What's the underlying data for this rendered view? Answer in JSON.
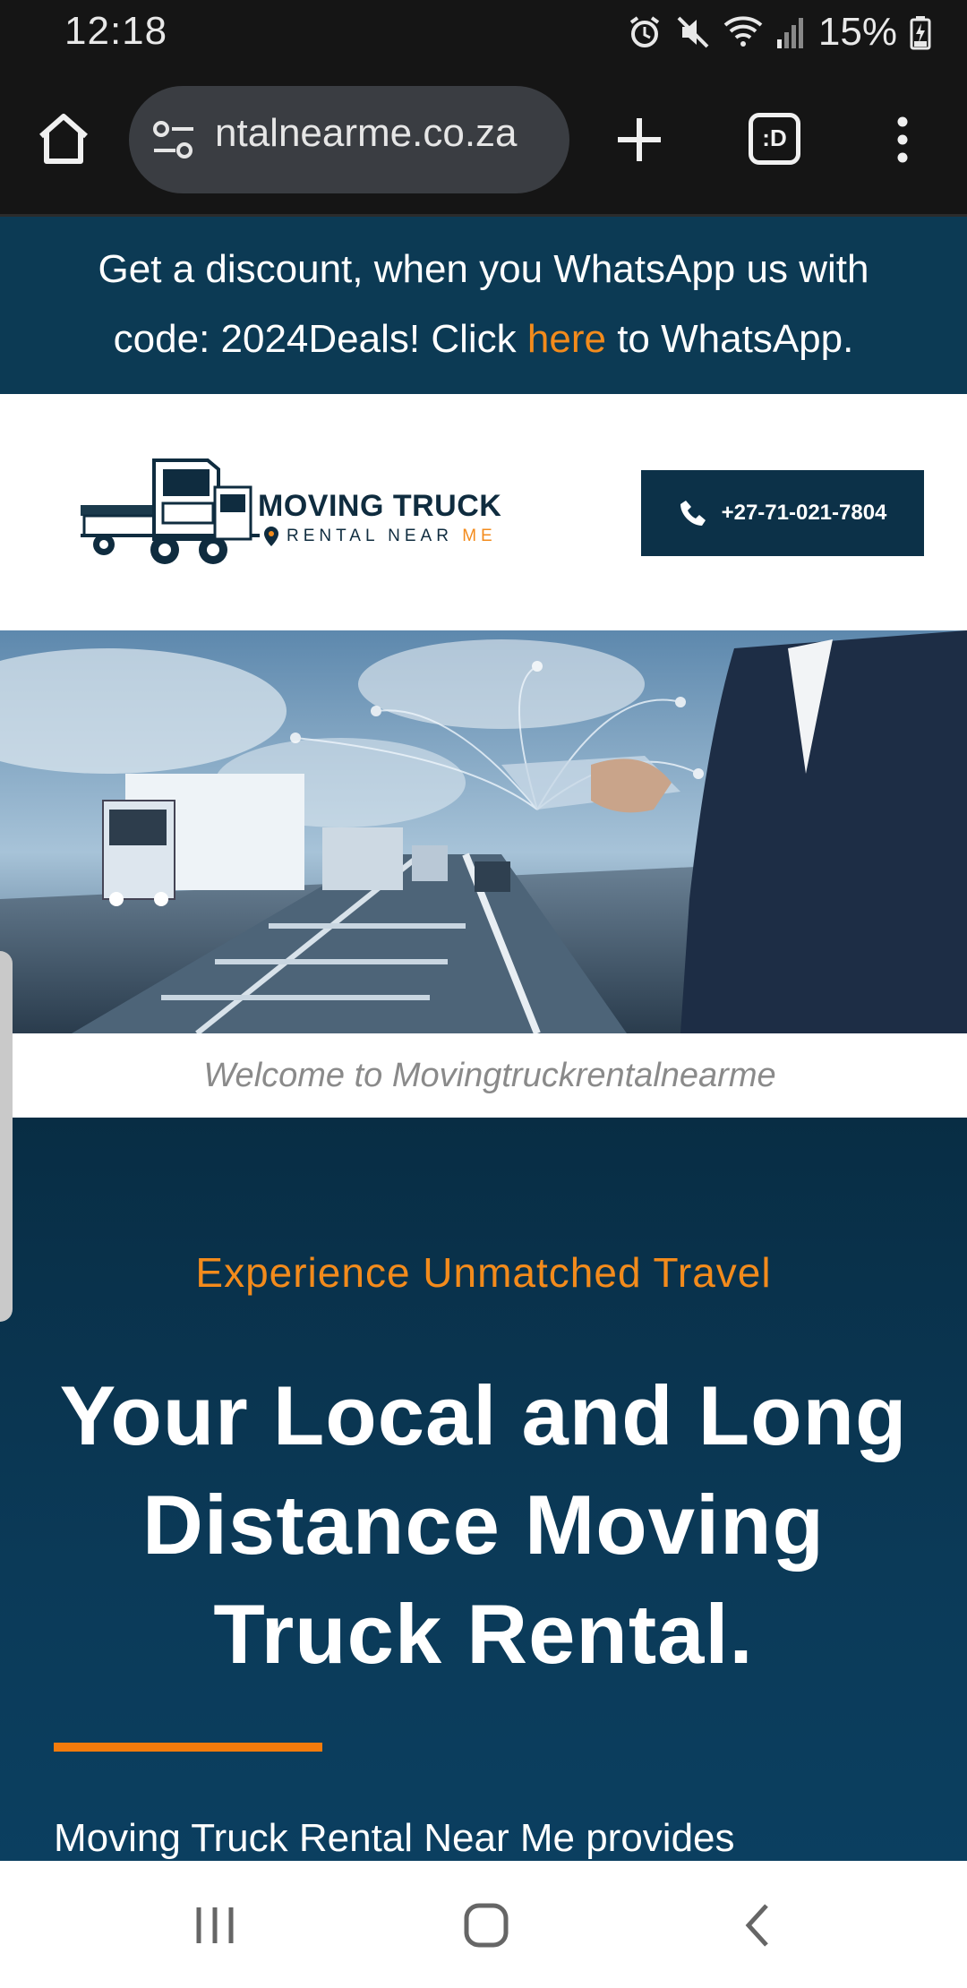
{
  "status": {
    "time": "12:18",
    "battery": "15%",
    "icons": [
      "alarm-icon",
      "mute-icon",
      "wifi-icon",
      "signal-icon",
      "battery-icon"
    ]
  },
  "browser": {
    "url": "ntalnearme.co.za",
    "tab_icon_label": ":D",
    "icons": [
      "home-icon",
      "site-settings-icon",
      "new-tab-icon",
      "tabs-icon",
      "menu-icon"
    ]
  },
  "promo": {
    "line1": "Get a discount, when you WhatsApp us with",
    "line2_before": "code: 2024Deals! Click ",
    "link": "here",
    "line2_after": " to WhatsApp."
  },
  "header": {
    "logo_title": "MOVING TRUCK",
    "logo_sub": "RENTAL NEAR ",
    "logo_sub_accent": "ME",
    "phone": "+27-71-021-7804"
  },
  "hero": {
    "caption": "Welcome to Movingtruckrentalnearme"
  },
  "main": {
    "eyebrow": "Experience Unmatched Travel",
    "headline_1": "Your Local and Long",
    "headline_2": "Distance Moving",
    "headline_3": "Truck Rental.",
    "body": "Moving Truck Rental Near Me provides"
  },
  "colors": {
    "navy": "#0c3a54",
    "orange": "#f38b1c",
    "white": "#ffffff"
  }
}
